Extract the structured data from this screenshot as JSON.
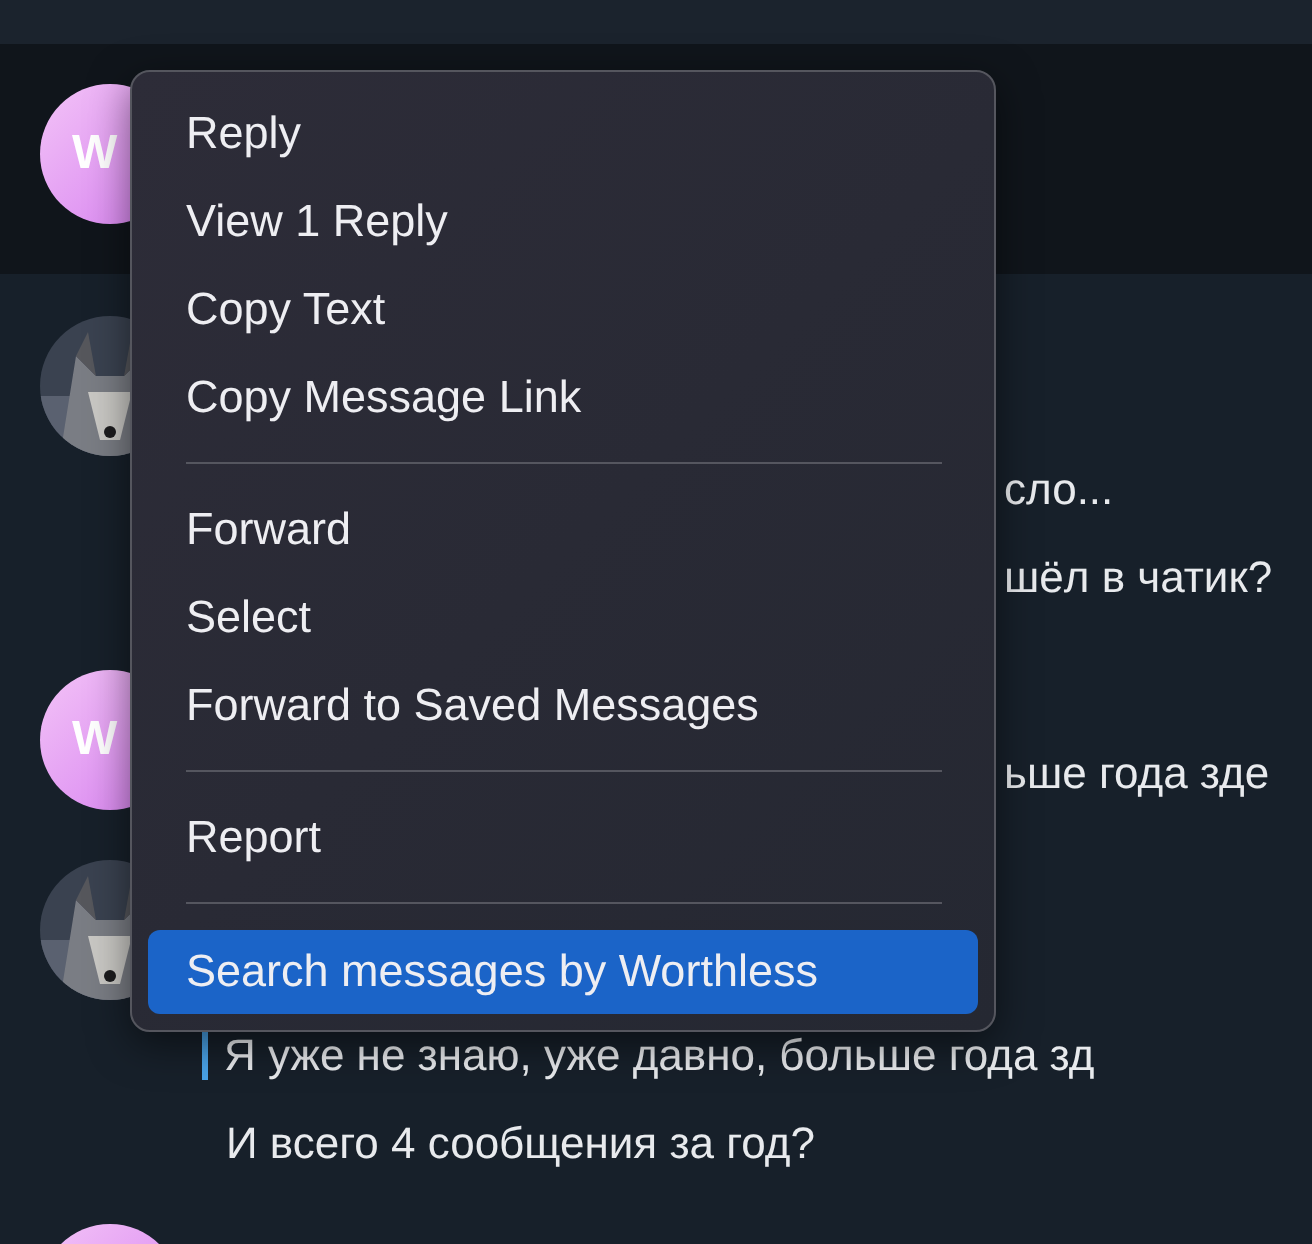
{
  "chat": {
    "messages": [
      {
        "avatar": {
          "kind": "initials",
          "text": "W"
        },
        "highlighted": true
      },
      {
        "highlighted": false,
        "lines": [
          {
            "kind": "covered",
            "text": "сло..."
          },
          {
            "kind": "covered",
            "text": "шёл в чатик?"
          }
        ]
      },
      {
        "avatar": {
          "kind": "initials",
          "text": "W"
        },
        "highlighted": false,
        "lines": [
          {
            "kind": "covered",
            "text": "ьше года зде"
          }
        ]
      },
      {
        "highlighted": false,
        "lines": [
          {
            "kind": "quote",
            "text": "Я уже не знаю, уже давно, больше года зд"
          },
          {
            "kind": "plain",
            "text": "И всего 4 сообщения за год?"
          }
        ]
      },
      {
        "avatar": {
          "kind": "initials"
        },
        "highlighted": false
      }
    ]
  },
  "menu": {
    "items": [
      {
        "kind": "item",
        "label": "Reply",
        "selected": false
      },
      {
        "kind": "item",
        "label": "View 1 Reply",
        "selected": false
      },
      {
        "kind": "item",
        "label": "Copy Text",
        "selected": false
      },
      {
        "kind": "item",
        "label": "Copy Message Link",
        "selected": false
      },
      {
        "kind": "separator"
      },
      {
        "kind": "item",
        "label": "Forward",
        "selected": false
      },
      {
        "kind": "item",
        "label": "Select",
        "selected": false
      },
      {
        "kind": "item",
        "label": "Forward to Saved Messages",
        "selected": false
      },
      {
        "kind": "separator"
      },
      {
        "kind": "item",
        "label": "Report",
        "selected": false
      },
      {
        "kind": "separator"
      },
      {
        "kind": "item",
        "label": "Search messages by Worthless",
        "selected": true
      }
    ]
  }
}
